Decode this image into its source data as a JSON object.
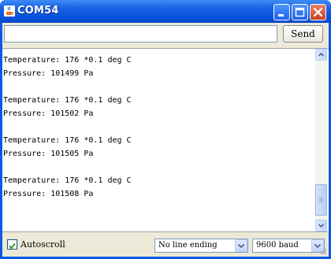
{
  "window": {
    "title": "COM54",
    "icon": "java-cup-icon",
    "controls": [
      "minimize-icon",
      "maximize-icon",
      "close-icon"
    ]
  },
  "send": {
    "input_value": "",
    "button_label": "Send"
  },
  "console": {
    "lines": [
      "Temperature: 176 *0.1 deg C",
      "Pressure: 101499 Pa",
      "",
      "Temperature: 176 *0.1 deg C",
      "Pressure: 101502 Pa",
      "",
      "Temperature: 176 *0.1 deg C",
      "Pressure: 101505 Pa",
      "",
      "Temperature: 176 *0.1 deg C",
      "Pressure: 101508 Pa"
    ]
  },
  "footer": {
    "autoscroll_label": "Autoscroll",
    "autoscroll_checked": true,
    "line_ending": "No line ending",
    "baud_rate": "9600 baud"
  },
  "colors": {
    "titlebar": "#0a55de",
    "client_bg": "#ece9d8",
    "close_button": "#c8412a"
  }
}
